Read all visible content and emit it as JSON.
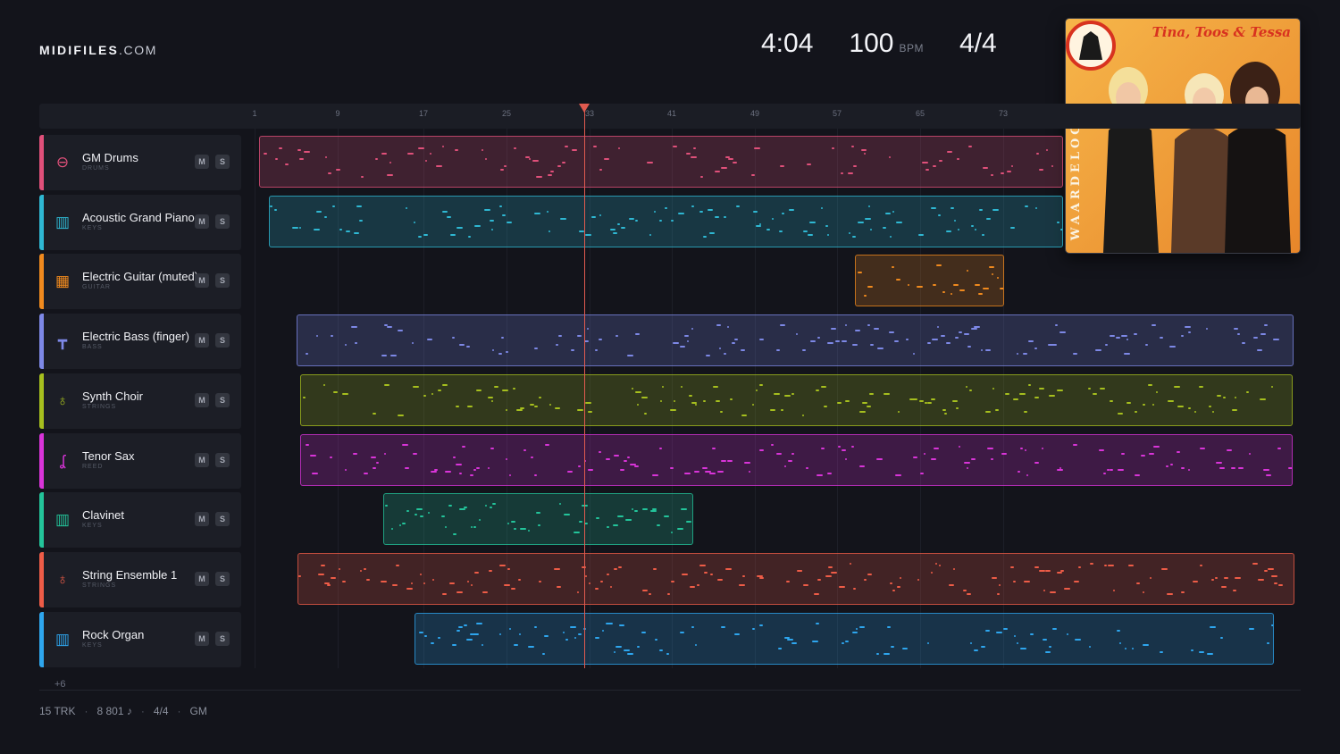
{
  "brand": {
    "name": "MIDIFILES",
    "domain": ".COM"
  },
  "stats": {
    "duration": "4:04",
    "tempo": "100",
    "tempo_unit": "BPM",
    "time_signature": "4/4"
  },
  "cover": {
    "title": "Tina, Toos & Tessa",
    "album": "WAARDELOOS"
  },
  "ruler": {
    "ticks": [
      "1",
      "9",
      "17",
      "25",
      "33",
      "41",
      "49",
      "57",
      "65",
      "73"
    ]
  },
  "playhead_bar": 33,
  "tracks": [
    {
      "name": "GM Drums",
      "category": "DRUMS",
      "color": "#e0507a",
      "icon": "drum-icon"
    },
    {
      "name": "Acoustic Grand Piano",
      "category": "KEYS",
      "color": "#2fb8d3",
      "icon": "piano-keys-icon"
    },
    {
      "name": "Electric Guitar (muted)",
      "category": "GUITAR",
      "color": "#f08a1e",
      "icon": "guitar-icon"
    },
    {
      "name": "Electric Bass (finger)",
      "category": "BASS",
      "color": "#7d88e6",
      "icon": "bass-icon"
    },
    {
      "name": "Synth Choir",
      "category": "STRINGS",
      "color": "#a6bf1e",
      "icon": "strings-icon"
    },
    {
      "name": "Tenor Sax",
      "category": "REED",
      "color": "#d934d9",
      "icon": "sax-icon"
    },
    {
      "name": "Clavinet",
      "category": "KEYS",
      "color": "#23c49a",
      "icon": "piano-keys-icon"
    },
    {
      "name": "String Ensemble 1",
      "category": "STRINGS",
      "color": "#ee5c47",
      "icon": "strings-icon"
    },
    {
      "name": "Rock Organ",
      "category": "KEYS",
      "color": "#2ea6ee",
      "icon": "piano-keys-icon"
    }
  ],
  "track_buttons": {
    "mute": "M",
    "solo": "S"
  },
  "more_tracks": "+6",
  "footer": {
    "tracks": "15 TRK",
    "notes": "8 801 ♪",
    "signature": "4/4",
    "standard": "GM",
    "separator": "·"
  }
}
